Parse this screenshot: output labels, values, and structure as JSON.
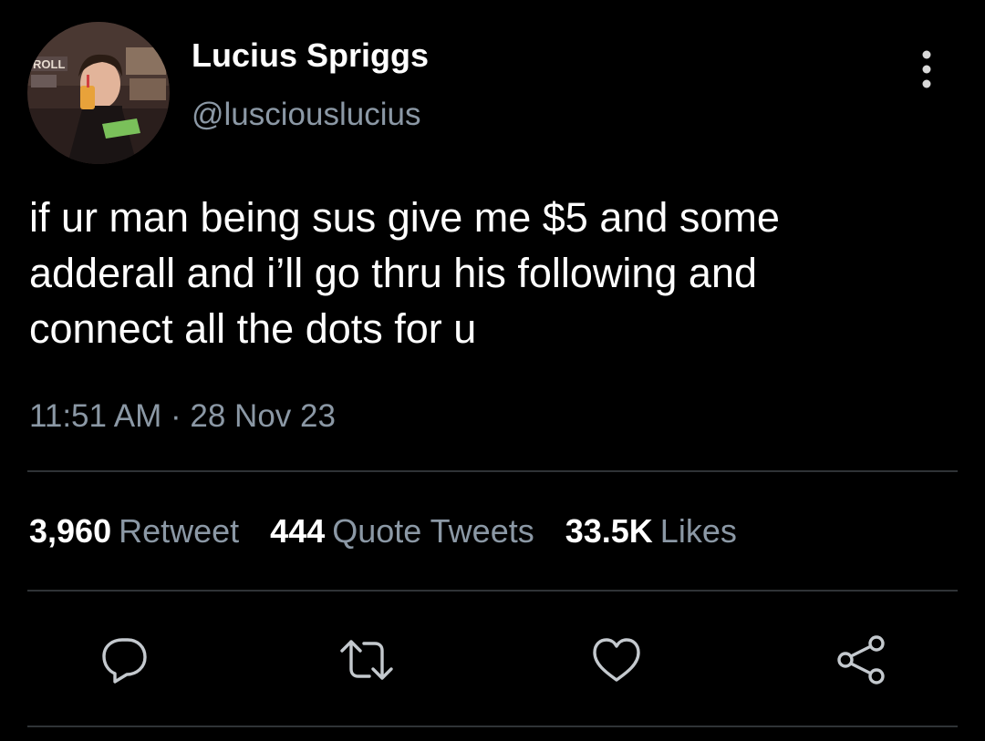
{
  "user": {
    "display_name": "Lucius Spriggs",
    "handle": "@lusciouslucius",
    "avatar_sign": "ROLL"
  },
  "tweet": {
    "text_lines": [
      "if ur man being sus give me $5 and some",
      "adderall and i’ll go thru his following and",
      "connect all the dots for u"
    ],
    "time": "11:51 AM",
    "separator": "·",
    "date": "28 Nov 23"
  },
  "stats": {
    "retweets": {
      "count": "3,960",
      "label": "Retweet"
    },
    "quotes": {
      "count": "444",
      "label": "Quote Tweets"
    },
    "likes": {
      "count": "33.5K",
      "label": "Likes"
    }
  },
  "actions": [
    "reply-icon",
    "retweet-icon",
    "like-icon",
    "share-icon"
  ],
  "colors": {
    "background": "#000000",
    "primary_text": "#ffffff",
    "secondary_text": "#8b98a5",
    "divider": "#2f3336"
  }
}
